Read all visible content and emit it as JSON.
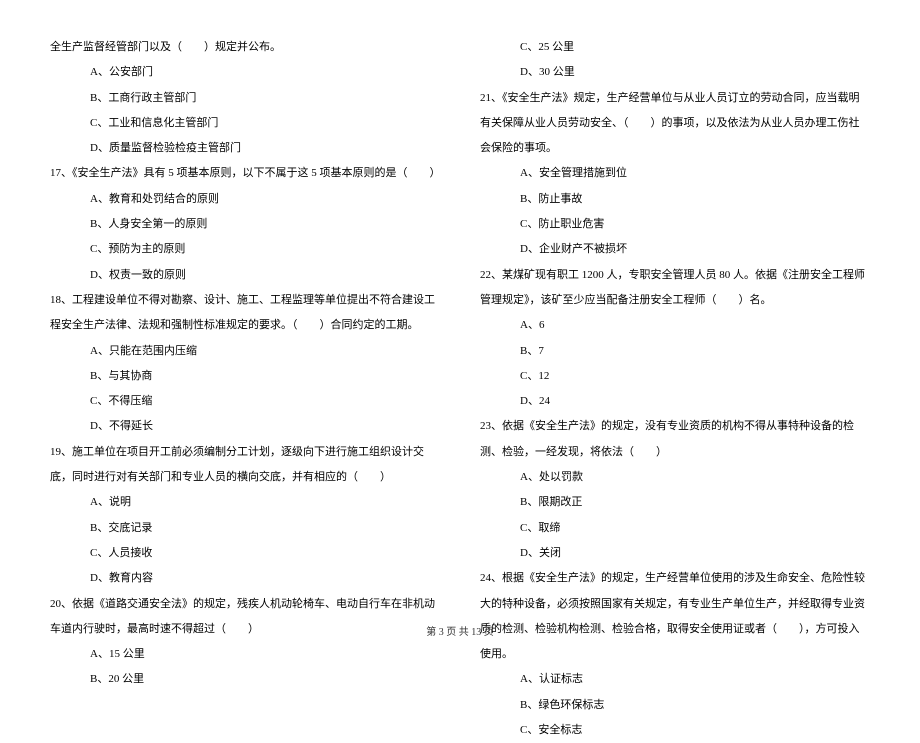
{
  "left_column": {
    "q16_tail": "全生产监督经管部门以及（　　）规定并公布。",
    "q16_options": [
      "A、公安部门",
      "B、工商行政主管部门",
      "C、工业和信息化主管部门",
      "D、质量监督检验检疫主管部门"
    ],
    "q17": "17、《安全生产法》具有 5 项基本原则，以下不属于这 5 项基本原则的是（　　）",
    "q17_options": [
      "A、教育和处罚结合的原则",
      "B、人身安全第一的原则",
      "C、预防为主的原则",
      "D、权责一致的原则"
    ],
    "q18": "18、工程建设单位不得对勘察、设计、施工、工程监理等单位提出不符合建设工程安全生产法律、法规和强制性标准规定的要求。（　　）合同约定的工期。",
    "q18_options": [
      "A、只能在范围内压缩",
      "B、与其协商",
      "C、不得压缩",
      "D、不得延长"
    ],
    "q19": "19、施工单位在项目开工前必须编制分工计划，逐级向下进行施工组织设计交底，同时进行对有关部门和专业人员的横向交底，并有相应的（　　）",
    "q19_options": [
      "A、说明",
      "B、交底记录",
      "C、人员接收",
      "D、教育内容"
    ],
    "q20": "20、依据《道路交通安全法》的规定，残疾人机动轮椅车、电动自行车在非机动车道内行驶时，最高时速不得超过（　　）",
    "q20_options": [
      "A、15 公里",
      "B、20 公里"
    ]
  },
  "right_column": {
    "q20_options_cont": [
      "C、25 公里",
      "D、30 公里"
    ],
    "q21": "21、《安全生产法》规定，生产经营单位与从业人员订立的劳动合同，应当载明有关保障从业人员劳动安全、（　　）的事项，以及依法为从业人员办理工伤社会保险的事项。",
    "q21_options": [
      "A、安全管理措施到位",
      "B、防止事故",
      "C、防止职业危害",
      "D、企业财产不被损坏"
    ],
    "q22": "22、某煤矿现有职工 1200 人，专职安全管理人员 80 人。依据《注册安全工程师管理规定》，该矿至少应当配备注册安全工程师（　　）名。",
    "q22_options": [
      "A、6",
      "B、7",
      "C、12",
      "D、24"
    ],
    "q23": "23、依据《安全生产法》的规定，没有专业资质的机构不得从事特种设备的检测、检验，一经发现，将依法（　　）",
    "q23_options": [
      "A、处以罚款",
      "B、限期改正",
      "C、取缔",
      "D、关闭"
    ],
    "q24": "24、根据《安全生产法》的规定，生产经营单位使用的涉及生命安全、危险性较大的特种设备，必须按照国家有关规定，有专业生产单位生产，并经取得专业资质的检测、检验机构检测、检验合格，取得安全使用证或者（　　），方可投入使用。",
    "q24_options": [
      "A、认证标志",
      "B、绿色环保标志",
      "C、安全标志"
    ]
  },
  "footer": "第 3 页 共 13 页"
}
